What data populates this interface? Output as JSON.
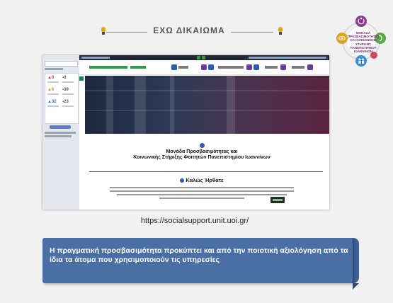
{
  "header": {
    "title": "ΕΧΩ ΔΙΚΑΙΩΜΑ"
  },
  "logo": {
    "text": "ΜΟΝΑΔΑ ΠΡΟΣΒΑΣΙΜΟΤΗΤΑΣ ΚΑΙ ΚΟΙΝΩΝΙΚΗΣ ΣΤΗΡΙΞΗΣ ΠΑΝΕΠΙΣΤΗΜΙΟΥ ΙΩΑΝΝΙΝΩΝ",
    "colors": [
      "#8e3a8e",
      "#e0a11c",
      "#5aa84a",
      "#3a8fd4",
      "#d4465a"
    ]
  },
  "screenshot": {
    "site_title_line1": "Μονάδα Προσβασιμότητας και",
    "site_title_line2": "Κοινωνικής Στήριξης Φοιτητών Πανεπιστημίου Ιωαννίνων",
    "welcome": "Καλώς Ήρθατε",
    "accent": "#2a5db0"
  },
  "url": "https://socialsupport.unit.uoi.gr/",
  "quote": {
    "text": "Η πραγματική προσβασιμότητα προκύπτει και από την ποιοτική αξιολόγηση από τα ίδια τα άτομα που χρησιμοποιούν τις υπηρεσίες",
    "background": "#4a6fa5"
  }
}
